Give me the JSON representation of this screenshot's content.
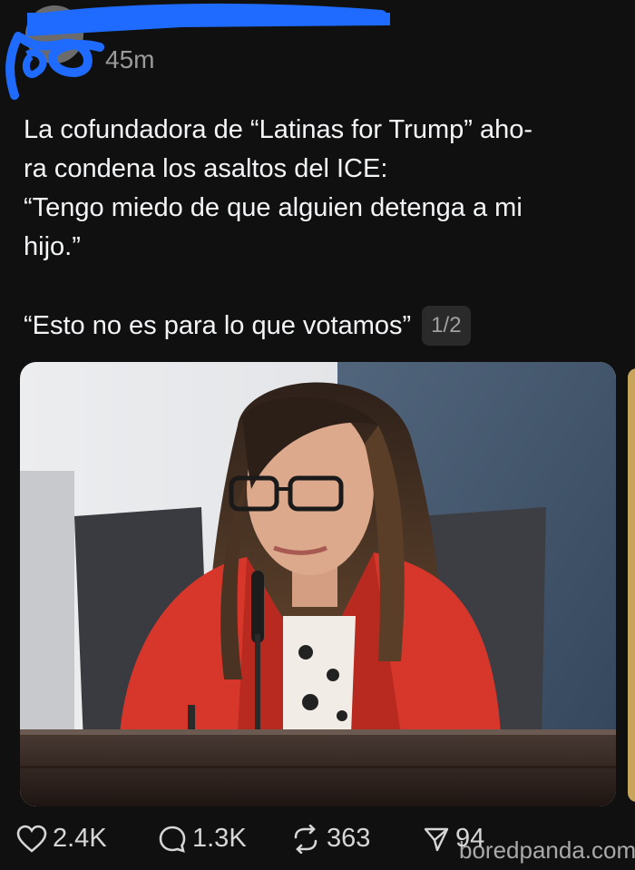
{
  "post": {
    "timestamp": "45m",
    "text_lines": [
      "La cofundadora de “Latinas for Trump” aho-",
      "ra condena los asaltos del ICE:",
      "“Tengo miedo de que alguien detenga a mi",
      "hijo.”"
    ],
    "quote": "“Esto no es para lo que votamos”",
    "page_indicator": "1/2"
  },
  "actions": {
    "likes": "2.4K",
    "replies": "1.3K",
    "reposts": "363",
    "shares": "94"
  },
  "watermark": "boredpanda.com",
  "colors": {
    "background": "#101010",
    "redaction": "#1f6bff",
    "text": "#f3f5f7",
    "muted": "#9a9a9a"
  }
}
